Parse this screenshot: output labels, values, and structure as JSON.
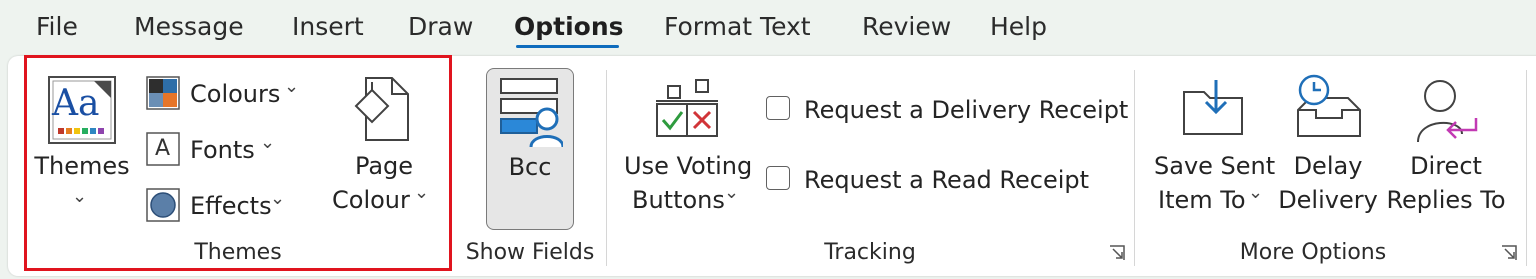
{
  "menu": {
    "tabs": [
      "File",
      "Message",
      "Insert",
      "Draw",
      "Options",
      "Format Text",
      "Review",
      "Help"
    ],
    "active_tab": "Options"
  },
  "themes_group": {
    "label": "Themes",
    "themes_button": "Themes",
    "colours_button": "Colours",
    "fonts_button": "Fonts",
    "effects_button": "Effects",
    "page_colour_line1": "Page",
    "page_colour_line2": "Colour",
    "themes_icon_text": "Aa",
    "fonts_icon_text": "A"
  },
  "show_fields_group": {
    "label": "Show Fields",
    "bcc_button": "Bcc",
    "bcc_active": true
  },
  "tracking_group": {
    "label": "Tracking",
    "voting_line1": "Use Voting",
    "voting_line2": "Buttons",
    "delivery_receipt": "Request a Delivery Receipt",
    "delivery_receipt_checked": false,
    "read_receipt": "Request a Read Receipt",
    "read_receipt_checked": false
  },
  "more_options_group": {
    "label": "More Options",
    "save_sent_line1": "Save Sent",
    "save_sent_line2": "Item To",
    "delay_line1": "Delay",
    "delay_line2": "Delivery",
    "direct_line1": "Direct",
    "direct_line2": "Replies To"
  },
  "colors": {
    "accent": "#0f6cbd",
    "highlight_box": "#e0141e",
    "ribbon_bg": "#ffffff",
    "window_bg": "#eef3ef"
  }
}
